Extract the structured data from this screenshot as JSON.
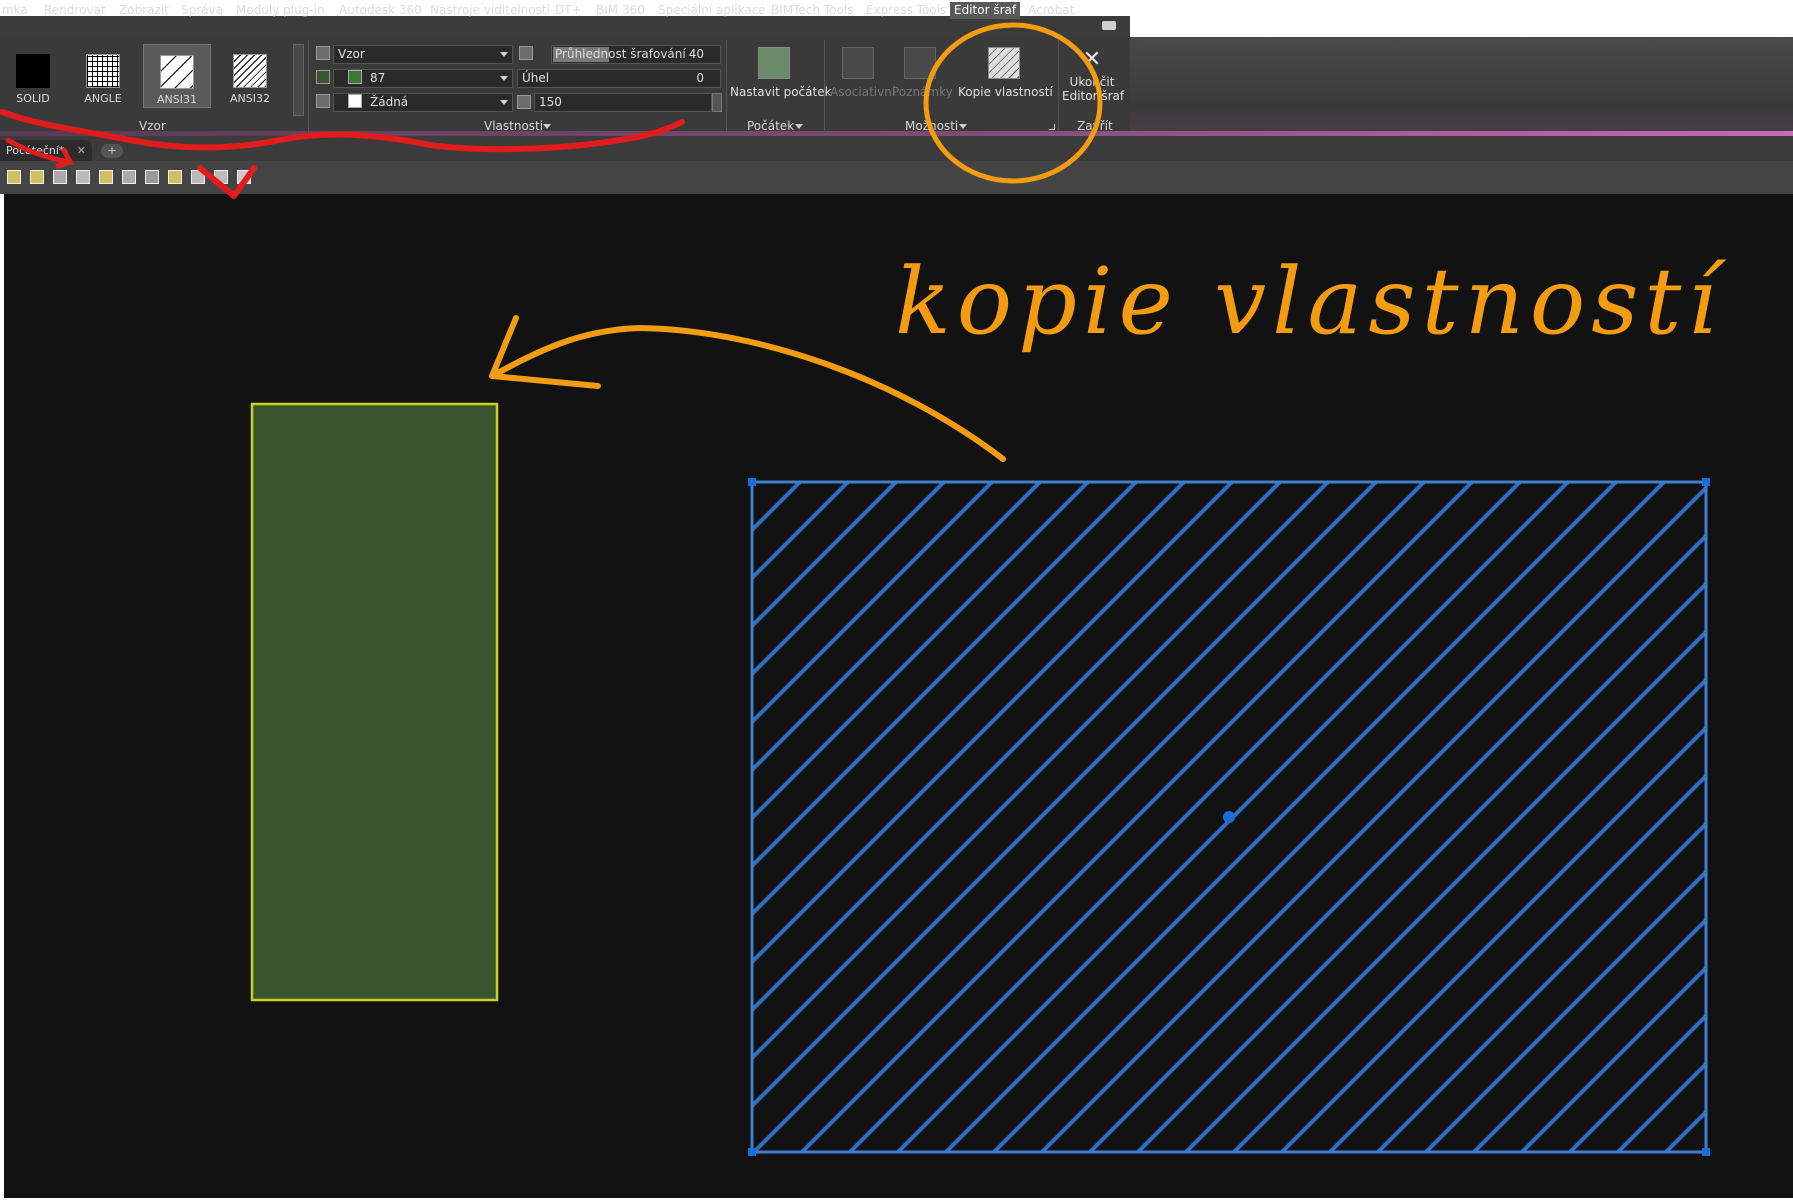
{
  "menu": {
    "items": [
      "mka",
      "Rendrovat",
      "Zobrazit",
      "Správa",
      "Moduly plug-in",
      "Autodesk 360",
      "Nástroje viditelnosti",
      "DT+",
      "BIM 360",
      "Speciální aplikace",
      "BIMTech Tools",
      "Express Tools",
      "Editor šraf",
      "Acrobat"
    ],
    "active": "Editor šraf"
  },
  "ribbon": {
    "pattern_panel": {
      "label": "Vzor",
      "swatches": [
        "SOLID",
        "ANGLE",
        "ANSI31",
        "ANSI32"
      ],
      "selected": "ANSI31"
    },
    "properties_panel": {
      "label": "Vlastnosti",
      "type_value": "Vzor",
      "color_value": "87",
      "background_value": "Žádná",
      "transparency_label": "Průhlednost šrafování",
      "transparency_value": "40",
      "angle_label": "Úhel",
      "angle_value": "0",
      "scale_value": "150"
    },
    "origin_panel": {
      "label": "Počátek",
      "set_origin_label": "Nastavit počátek"
    },
    "options_panel": {
      "label": "Možnosti",
      "associative_label": "Asociativní",
      "annotative_label": "Poznámky",
      "copy_props_label": "Kopie vlastností"
    },
    "close_panel": {
      "label": "Zavřít",
      "close_label_line1": "Ukončit",
      "close_label_line2": "Editor šraf"
    }
  },
  "tabs": {
    "file_tab": "Počáteční*",
    "plus": "+"
  },
  "annotation": {
    "text": "kopie vlastností",
    "color": "#f39c12"
  },
  "colors": {
    "canvas_bg": "#121212",
    "green_fill": "#3a5530",
    "green_border": "#c8d020",
    "hatch_blue": "#2f6fc4",
    "grip_blue": "#1a6fd6",
    "red_mark": "#e01c1c",
    "orange_mark": "#f39c12"
  }
}
